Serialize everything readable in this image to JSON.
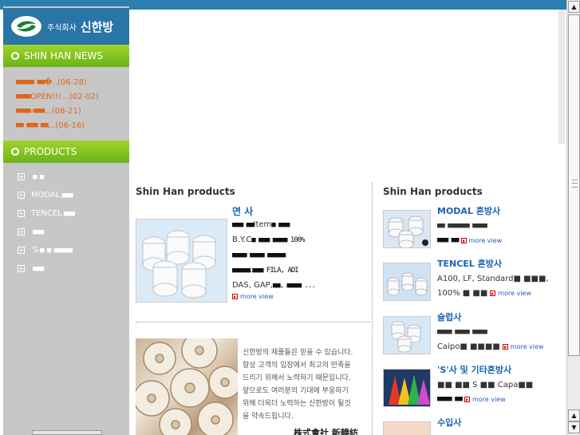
{
  "header": {
    "logo_small": "주식회사",
    "logo_big": "신한방"
  },
  "sidebar": {
    "news_title": "SHIN HAN NEWS",
    "news": [
      {
        "blocks": "■■■■■ ■■",
        "text": "�..(06-28)"
      },
      {
        "blocks": "■■■■",
        "text": " OPEN!!!...(02-02)"
      },
      {
        "blocks": "■■■■↓■■■",
        "text": "...(08-21)"
      },
      {
        "blocks": "■■ ■■■ ■■",
        "text": "...(06-16)"
      }
    ],
    "products_title": "PRODUCTS",
    "products": [
      {
        "text": "",
        "blocks": "■ ■"
      },
      {
        "text": "MODAL",
        "blocks": "■■■"
      },
      {
        "text": "TENCEL",
        "blocks": "■■■"
      },
      {
        "text": "",
        "blocks": "■■■"
      },
      {
        "text": "'S",
        "blocks": "■ ■ ■■■■■"
      },
      {
        "text": "",
        "blocks": "■■■"
      }
    ]
  },
  "left_column": {
    "title": "Shin Han products",
    "product_title": "면 사",
    "lines": [
      {
        "blocks1": "■■■ ■■",
        "text": " Item",
        "blocks2": "■ ■■■"
      },
      {
        "blocks1": "",
        "text": "B.Y.C",
        "blocks2": "■ ■■■ ■■■■ 100%"
      },
      {
        "blocks1": "■■■■ ■■■■ ■■■■■",
        "text": "",
        "blocks2": ""
      },
      {
        "blocks1": "■■■■■",
        "text": ". ",
        "blocks2": "■■■ FILA, ADI"
      },
      {
        "blocks1": "",
        "text": "DAS, GAP, ",
        "blocks2": "■■, ■■■■ ..."
      }
    ],
    "more_label": "more view",
    "promo_lines": [
      "신한방의 제품들은 믿을 수 있습니다.",
      "항상 고객의 입장에서 최고의 만족을",
      "드리기 위해서 노력하기 때문입니다.",
      "앞으로도 여러분의 기대에 부응하기",
      "위해 더욱더 노력하는 신한방이 될것",
      "을 약속드립니다."
    ],
    "promo_signature": "株式會社 新韓紡"
  },
  "right_column": {
    "title": "Shin Han products",
    "items": [
      {
        "title": "MODAL 혼방사",
        "line1": "■■ ■■■■■■ ■■■■",
        "line2": "■■■ ■■",
        "more": "more view"
      },
      {
        "title": "TENCEL 혼방사",
        "line1": "A100, LF, Standard■ ■■■,",
        "line2": "100% ■ ■■",
        "more": "more view"
      },
      {
        "title": "슬럽사",
        "line1": "■■■■ ■■■■ ■■■■",
        "line2": "Caipo■ ■■■■",
        "more": "more view"
      },
      {
        "title": "'S'사 및 기타혼방사",
        "line1": "■■ ■■ S ■■ Capa■■",
        "line2": "■■■■ ■■",
        "more": "more view"
      },
      {
        "title": "수입사",
        "line1": "",
        "line2": "",
        "more": ""
      }
    ]
  },
  "colors": {
    "accent_green": "#7cc21e",
    "brand_blue": "#2a74a6",
    "news_orange": "#e0661a",
    "link_blue": "#1a63b3"
  }
}
